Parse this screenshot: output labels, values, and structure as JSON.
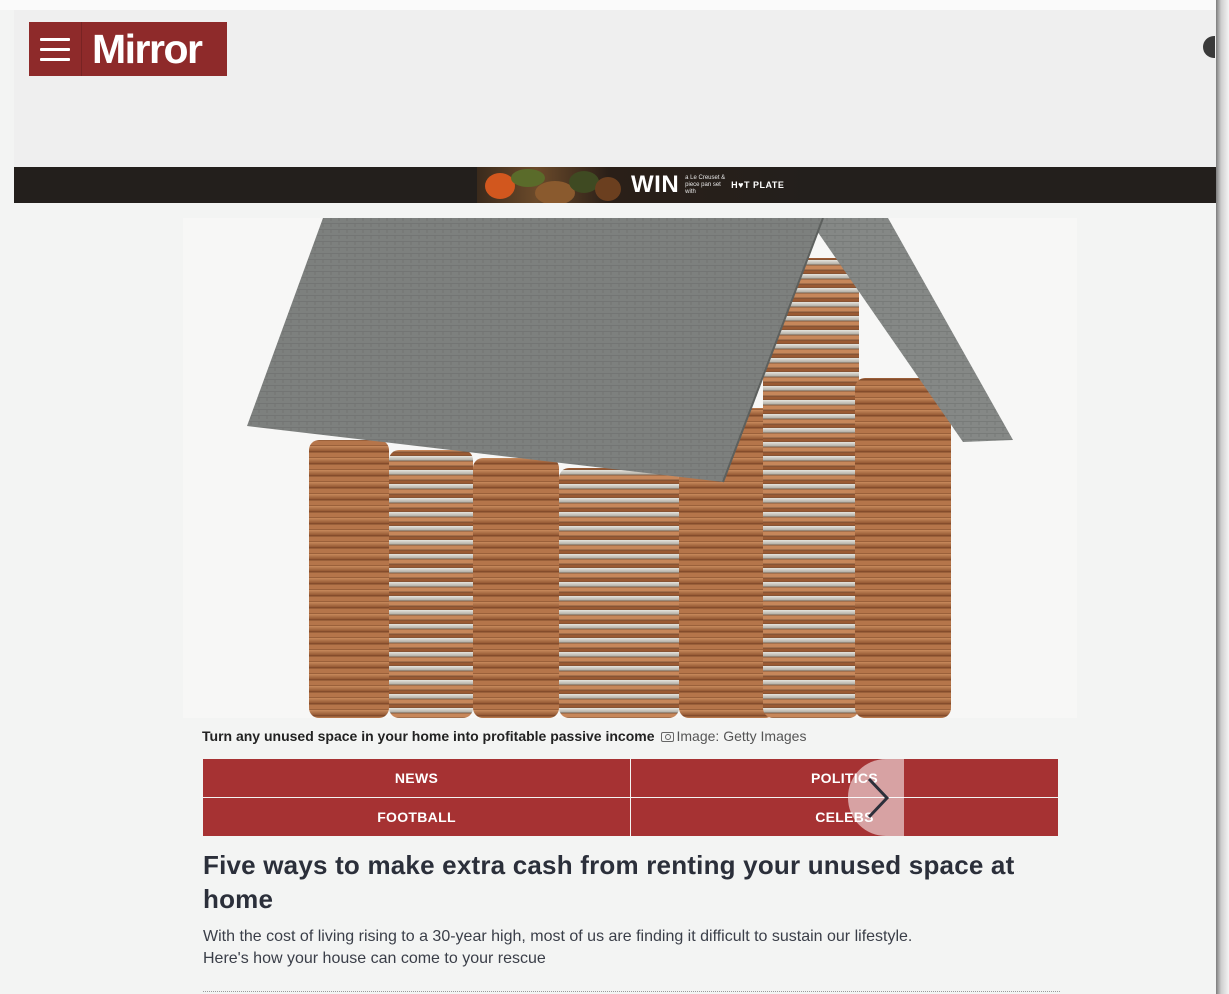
{
  "header": {
    "logo_text": "Mirror",
    "menu_icon": "hamburger-menu-icon",
    "brand_color": "#8e2a2a"
  },
  "ad": {
    "win_text": "WIN",
    "small_text": "a Le Creuset & piece pan set with",
    "partner_text": "H♥T PLATE"
  },
  "article": {
    "image_alt": "Stacks of coins forming a house with a grey roof",
    "caption": "Turn any unused space in your home into profitable passive income",
    "credit": "Image: Getty Images",
    "headline": "Five ways to make extra cash from renting your unused space at home",
    "standfirst_line1": "With the cost of living rising to a 30-year high, most of us are finding it difficult to sustain our lifestyle.",
    "standfirst_line2": "Here's how your house can come to your rescue"
  },
  "nav": {
    "items": [
      {
        "label": "NEWS"
      },
      {
        "label": "POLITICS"
      },
      {
        "label": "FOOTBALL"
      },
      {
        "label": "CELEBS"
      }
    ],
    "accent": "#a63233",
    "scroll_icon": "chevron-right-icon"
  }
}
